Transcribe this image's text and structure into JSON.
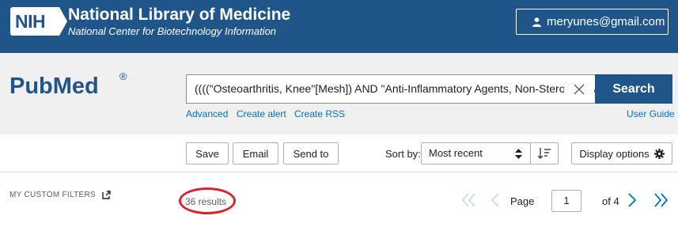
{
  "banner": {
    "logo": "NIH",
    "title": "National Library of Medicine",
    "subtitle": "National Center for Biotechnology Information",
    "user_email": "meryunes@gmail.com"
  },
  "brand": {
    "logo": "PubMed",
    "registered": "®"
  },
  "search": {
    "query": "((((\"Osteoarthritis, Knee\"[Mesh]) AND \"Anti-Inflammatory Agents, Non-Steroidal\"[Mesh]",
    "button": "Search",
    "links": [
      "Advanced",
      "Create alert",
      "Create RSS"
    ],
    "user_guide": "User Guide"
  },
  "toolbar": {
    "save": "Save",
    "email": "Email",
    "send_to": "Send to",
    "sort_label": "Sort by:",
    "sort_value": "Most recent",
    "display_options": "Display options"
  },
  "results": {
    "filters_label": "MY CUSTOM FILTERS",
    "count_text": "36 results",
    "page_label": "Page",
    "page_value": "1",
    "of_pages": "of 4"
  },
  "colors": {
    "brand_blue": "#20558a",
    "link_blue": "#0071bc",
    "highlight_red": "#d9232e"
  }
}
